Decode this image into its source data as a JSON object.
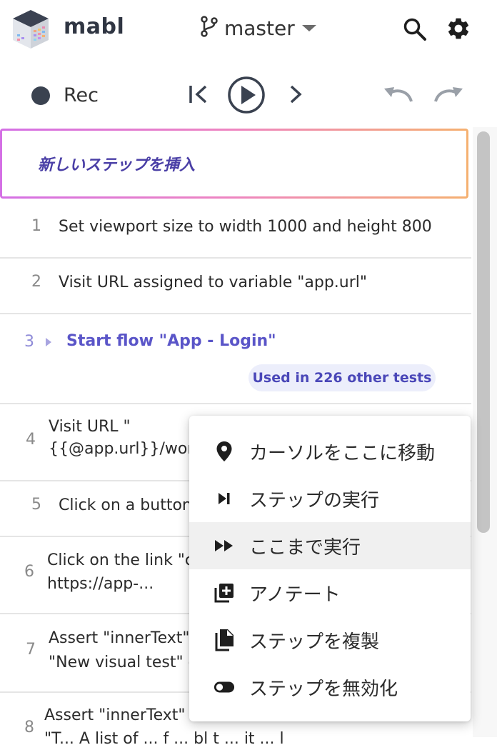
{
  "header": {
    "brand": "mabl",
    "branch": "master"
  },
  "toolbar": {
    "rec_label": "Rec"
  },
  "insert_step": {
    "label": "新しいステップを挿入"
  },
  "steps": [
    {
      "num": "1",
      "text": "Set viewport size to width 1000 and height 800"
    },
    {
      "num": "2",
      "text": "Visit URL assigned to variable \"app.url\""
    },
    {
      "num": "3",
      "text": "Start flow \"App - Login\"",
      "badge": "Used in 226 other tests"
    },
    {
      "num": "4",
      "line1": "Visit URL \"",
      "line2": "{{@app.url}}/work"
    },
    {
      "num": "5",
      "text": "Click on a button"
    },
    {
      "num": "6",
      "line1": "Click on the link \"c",
      "line2": "https://app-..."
    },
    {
      "num": "7",
      "line1": "Assert \"innerText\"",
      "line2": "\"New visual test\" c"
    },
    {
      "num": "8",
      "line1": "Assert \"innerText\"",
      "line2": "\"T... A list of ... f ... bl t ... it ... l"
    }
  ],
  "context_menu": {
    "items": [
      {
        "label": "カーソルをここに移動",
        "icon": "location-pin-icon"
      },
      {
        "label": "ステップの実行",
        "icon": "skip-next-icon"
      },
      {
        "label": "ここまで実行",
        "icon": "fast-forward-icon"
      },
      {
        "label": "アノテート",
        "icon": "add-note-icon"
      },
      {
        "label": "ステップを複製",
        "icon": "copy-icon"
      },
      {
        "label": "ステップを無効化",
        "icon": "toggle-icon"
      }
    ]
  },
  "colors": {
    "accent": "#5a55c8",
    "badge_bg": "#eceefb",
    "rec_dot": "#3a4250"
  }
}
